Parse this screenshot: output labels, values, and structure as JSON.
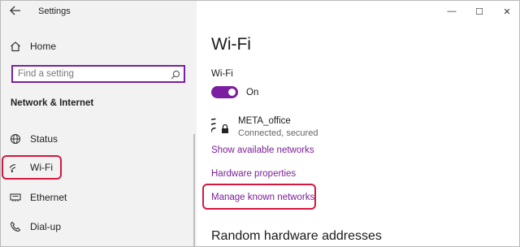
{
  "titlebar": {
    "title": "Settings",
    "back_icon": "back-arrow-icon"
  },
  "sidebar": {
    "home_label": "Home",
    "search": {
      "placeholder": "Find a setting"
    },
    "section_title": "Network & Internet",
    "items": [
      {
        "label": "Status",
        "icon": "globe-icon"
      },
      {
        "label": "Wi-Fi",
        "icon": "wifi-icon",
        "selected": true
      },
      {
        "label": "Ethernet",
        "icon": "ethernet-icon"
      },
      {
        "label": "Dial-up",
        "icon": "phone-icon"
      }
    ]
  },
  "window_controls": {
    "minimize": "—",
    "maximize": "☐",
    "close": "✕"
  },
  "content": {
    "page_title": "Wi-Fi",
    "toggle_label": "Wi-Fi",
    "toggle_state": "On",
    "network": {
      "name": "META_office",
      "status": "Connected, secured",
      "icon": "wifi-lock-icon"
    },
    "links": {
      "show_networks": "Show available networks",
      "hardware": "Hardware properties",
      "manage": "Manage known networks"
    },
    "section_random": "Random hardware addresses"
  },
  "colors": {
    "accent": "#7a1fa2",
    "link": "#7b1f97",
    "highlight": "#d5183f",
    "sidebar_bg": "#f2f2f2"
  }
}
